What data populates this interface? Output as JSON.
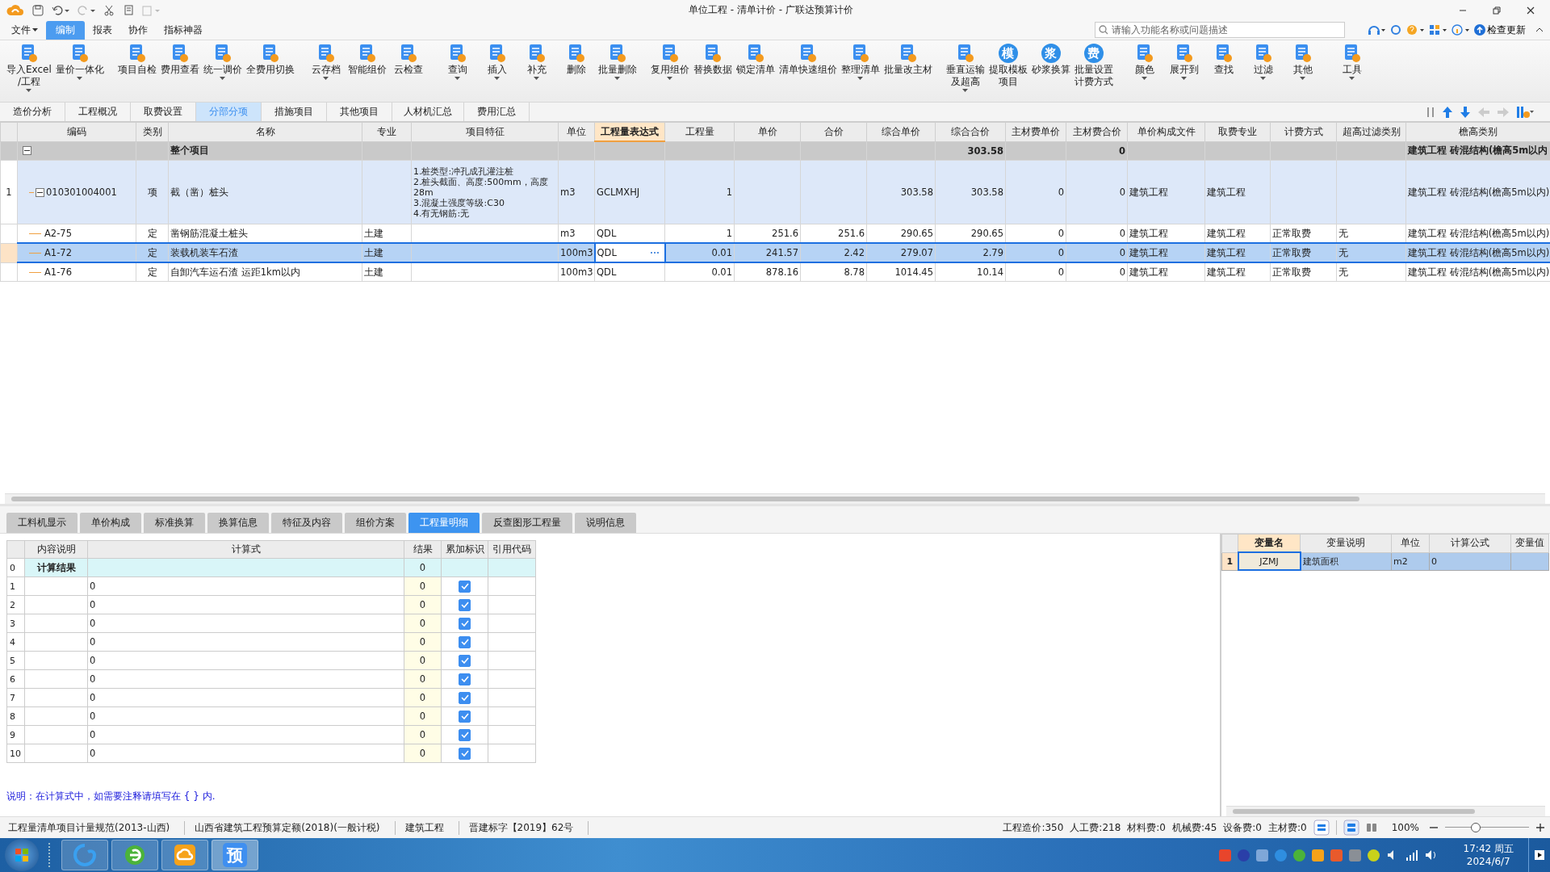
{
  "window": {
    "title": "单位工程 - 清单计价 - 广联达预算计价"
  },
  "menu": [
    {
      "label": "文件",
      "dropdown": true,
      "selected": false
    },
    {
      "label": "编制",
      "dropdown": false,
      "selected": true
    },
    {
      "label": "报表",
      "dropdown": false,
      "selected": false
    },
    {
      "label": "协作",
      "dropdown": false,
      "selected": false
    },
    {
      "label": "指标神器",
      "dropdown": false,
      "selected": false
    }
  ],
  "search": {
    "placeholder": "请输入功能名称或问题描述"
  },
  "check_update": "检查更新",
  "toolbar": [
    {
      "lines": [
        "导入Excel",
        "/工程"
      ],
      "dropdown": true
    },
    {
      "lines": [
        "量价一体化"
      ],
      "dropdown": true
    },
    {
      "lines": [
        "项目自检"
      ],
      "dropdown": false
    },
    {
      "lines": [
        "费用查看"
      ],
      "dropdown": false
    },
    {
      "lines": [
        "统一调价"
      ],
      "dropdown": true
    },
    {
      "lines": [
        "全费用切换"
      ],
      "dropdown": false
    },
    {
      "lines": [
        "云存档"
      ],
      "dropdown": true
    },
    {
      "lines": [
        "智能组价"
      ],
      "dropdown": false
    },
    {
      "lines": [
        "云检查"
      ],
      "dropdown": false
    },
    {
      "lines": [
        "查询"
      ],
      "dropdown": true
    },
    {
      "lines": [
        "插入"
      ],
      "dropdown": true
    },
    {
      "lines": [
        "补充"
      ],
      "dropdown": true
    },
    {
      "lines": [
        "删除"
      ],
      "dropdown": false
    },
    {
      "lines": [
        "批量删除"
      ],
      "dropdown": true
    },
    {
      "lines": [
        "复用组价"
      ],
      "dropdown": true
    },
    {
      "lines": [
        "替换数据"
      ],
      "dropdown": false
    },
    {
      "lines": [
        "锁定清单"
      ],
      "dropdown": false
    },
    {
      "lines": [
        "清单快速组价"
      ],
      "dropdown": false
    },
    {
      "lines": [
        "整理清单"
      ],
      "dropdown": true
    },
    {
      "lines": [
        "批量改主材"
      ],
      "dropdown": false
    },
    {
      "lines": [
        "垂直运输",
        "及超高"
      ],
      "dropdown": true
    },
    {
      "lines": [
        "提取模板",
        "项目"
      ],
      "dropdown": false,
      "glyph": "模"
    },
    {
      "lines": [
        "砂浆换算"
      ],
      "dropdown": false,
      "glyph": "浆"
    },
    {
      "lines": [
        "批量设置",
        "计费方式"
      ],
      "dropdown": false,
      "glyph": "费"
    },
    {
      "lines": [
        "颜色"
      ],
      "dropdown": true
    },
    {
      "lines": [
        "展开到"
      ],
      "dropdown": true
    },
    {
      "lines": [
        "查找"
      ],
      "dropdown": false
    },
    {
      "lines": [
        "过滤"
      ],
      "dropdown": true
    },
    {
      "lines": [
        "其他"
      ],
      "dropdown": true
    },
    {
      "lines": [
        "工具"
      ],
      "dropdown": true
    }
  ],
  "view_tabs": [
    {
      "label": "造价分析",
      "selected": false
    },
    {
      "label": "工程概况",
      "selected": false
    },
    {
      "label": "取费设置",
      "selected": false
    },
    {
      "label": "分部分项",
      "selected": true
    },
    {
      "label": "措施项目",
      "selected": false
    },
    {
      "label": "其他项目",
      "selected": false
    },
    {
      "label": "人材机汇总",
      "selected": false
    },
    {
      "label": "费用汇总",
      "selected": false
    }
  ],
  "table": {
    "columns": [
      {
        "label": "编码",
        "active": false
      },
      {
        "label": "类别",
        "active": false
      },
      {
        "label": "名称",
        "active": false
      },
      {
        "label": "专业",
        "active": false
      },
      {
        "label": "项目特征",
        "active": false
      },
      {
        "label": "单位",
        "active": false
      },
      {
        "label": "工程量表达式",
        "active": true
      },
      {
        "label": "工程量",
        "active": false
      },
      {
        "label": "单价",
        "active": false
      },
      {
        "label": "合价",
        "active": false
      },
      {
        "label": "综合单价",
        "active": false
      },
      {
        "label": "综合合价",
        "active": false
      },
      {
        "label": "主材费单价",
        "active": false
      },
      {
        "label": "主材费合价",
        "active": false
      },
      {
        "label": "单价构成文件",
        "active": false
      },
      {
        "label": "取费专业",
        "active": false
      },
      {
        "label": "计费方式",
        "active": false
      },
      {
        "label": "超高过滤类别",
        "active": false
      },
      {
        "label": "檐高类别",
        "active": false
      }
    ],
    "rows": [
      {
        "kind": "group",
        "expanded": true,
        "selected": false,
        "cells": [
          null,
          null,
          "整个项目",
          null,
          null,
          null,
          null,
          null,
          null,
          null,
          null,
          "303.58",
          null,
          "0",
          null,
          null,
          null,
          null,
          "建筑工程 砖混结构(檐高5m以内"
        ]
      },
      {
        "kind": "item",
        "row_number": "1",
        "expanded": true,
        "selected": false,
        "cells": [
          "010301004001",
          "项",
          "截（凿）桩头",
          null,
          "1.桩类型:冲孔成孔灌注桩\n2.桩头截面、高度:500mm，高度28m\n3.混凝土强度等级:C30\n4.有无钢筋:无",
          "m3",
          "GCLMXHJ",
          "1",
          null,
          null,
          "303.58",
          "303.58",
          "0",
          "0",
          "建筑工程",
          "建筑工程",
          null,
          null,
          "建筑工程 砖混结构(檐高5m以内)"
        ]
      },
      {
        "kind": "sub",
        "selected": false,
        "cells": [
          "A2-75",
          "定",
          "凿钢筋混凝土桩头",
          "土建",
          null,
          "m3",
          "QDL",
          "1",
          "251.6",
          "251.6",
          "290.65",
          "290.65",
          "0",
          "0",
          "建筑工程",
          "建筑工程",
          "正常取费",
          "无",
          "建筑工程 砖混结构(檐高5m以内)"
        ]
      },
      {
        "kind": "sub",
        "selected": true,
        "cells": [
          "A1-72",
          "定",
          "装载机装车石渣",
          "土建",
          null,
          "100m3",
          "QDL",
          "0.01",
          "241.57",
          "2.42",
          "279.07",
          "2.79",
          "0",
          "0",
          "建筑工程",
          "建筑工程",
          "正常取费",
          "无",
          "建筑工程 砖混结构(檐高5m以内)"
        ]
      },
      {
        "kind": "sub",
        "selected": false,
        "cells": [
          "A1-76",
          "定",
          "自卸汽车运石渣 运距1km以内",
          "土建",
          null,
          "100m3",
          "QDL",
          "0.01",
          "878.16",
          "8.78",
          "1014.45",
          "10.14",
          "0",
          "0",
          "建筑工程",
          "建筑工程",
          "正常取费",
          "无",
          "建筑工程 砖混结构(檐高5m以内)"
        ]
      }
    ]
  },
  "detail_tabs": [
    {
      "label": "工料机显示",
      "selected": false
    },
    {
      "label": "单价构成",
      "selected": false
    },
    {
      "label": "标准换算",
      "selected": false
    },
    {
      "label": "换算信息",
      "selected": false
    },
    {
      "label": "特征及内容",
      "selected": false
    },
    {
      "label": "组价方案",
      "selected": false
    },
    {
      "label": "工程量明细",
      "selected": true
    },
    {
      "label": "反查图形工程量",
      "selected": false
    },
    {
      "label": "说明信息",
      "selected": false
    }
  ],
  "quantity_detail": {
    "columns": [
      "内容说明",
      "计算式",
      "结果",
      "累加标识",
      "引用代码"
    ],
    "rows": [
      {
        "number": "0",
        "kind": "total",
        "description": "计算结果",
        "result": "0"
      },
      {
        "number": "1",
        "kind": "line",
        "formula": "0",
        "result": "0",
        "cumulative": true
      },
      {
        "number": "2",
        "kind": "line",
        "formula": "0",
        "result": "0",
        "cumulative": true
      },
      {
        "number": "3",
        "kind": "line",
        "formula": "0",
        "result": "0",
        "cumulative": true
      },
      {
        "number": "4",
        "kind": "line",
        "formula": "0",
        "result": "0",
        "cumulative": true
      },
      {
        "number": "5",
        "kind": "line",
        "formula": "0",
        "result": "0",
        "cumulative": true
      },
      {
        "number": "6",
        "kind": "line",
        "formula": "0",
        "result": "0",
        "cumulative": true
      },
      {
        "number": "7",
        "kind": "line",
        "formula": "0",
        "result": "0",
        "cumulative": true
      },
      {
        "number": "8",
        "kind": "line",
        "formula": "0",
        "result": "0",
        "cumulative": true
      },
      {
        "number": "9",
        "kind": "line",
        "formula": "0",
        "result": "0",
        "cumulative": true
      },
      {
        "number": "10",
        "kind": "line",
        "formula": "0",
        "result": "0",
        "cumulative": true
      }
    ]
  },
  "note": "说明：在计算式中，如需要注释请填写在 { } 内.",
  "variables": {
    "columns": [
      "变量名",
      "变量说明",
      "单位",
      "计算公式",
      "变量值"
    ],
    "rows": [
      {
        "number": "1",
        "name": "JZMJ",
        "description": "建筑面积",
        "unit": "m2",
        "formula": "0",
        "selected": true
      }
    ]
  },
  "status_bar": {
    "standards": [
      "工程量清单项目计量规范(2013-山西)",
      "山西省建筑工程预算定额(2018)(一般计税)",
      "建筑工程",
      "晋建标字【2019】62号"
    ],
    "totals": [
      "工程造价:350",
      "人工费:218",
      "材料费:0",
      "机械费:45",
      "设备费:0",
      "主材费:0"
    ],
    "zoom": "100%",
    "zoom_slider": {
      "level": 0.37
    }
  },
  "taskbar": {
    "app_label": "预",
    "time": "17:42 周五",
    "date": "2024/6/7"
  }
}
